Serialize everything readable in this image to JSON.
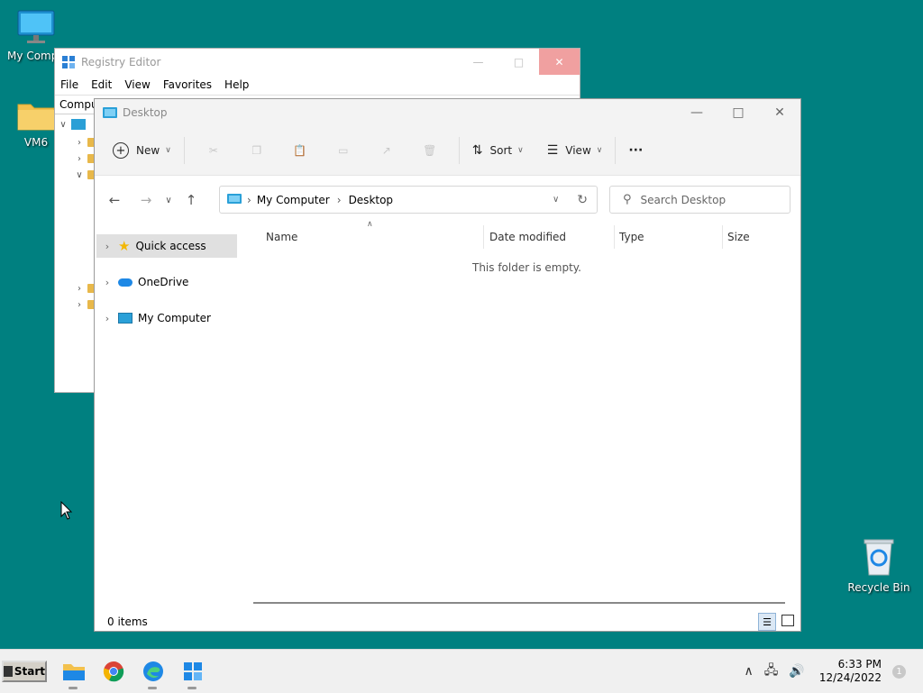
{
  "desktop": {
    "icons": [
      {
        "label": "My Compu"
      },
      {
        "label": "VM6"
      },
      {
        "label": "Recycle Bin"
      }
    ]
  },
  "regedit": {
    "title": "Registry Editor",
    "menu": [
      "File",
      "Edit",
      "View",
      "Favorites",
      "Help"
    ],
    "address": "Compu"
  },
  "explorer": {
    "title": "Desktop",
    "toolbar": {
      "new_label": "New",
      "sort_label": "Sort",
      "view_label": "View",
      "more_label": "···"
    },
    "breadcrumb": [
      "My Computer",
      "Desktop"
    ],
    "search_placeholder": "Search Desktop",
    "sidebar": [
      "Quick access",
      "OneDrive",
      "My Computer"
    ],
    "columns": [
      "Name",
      "Date modified",
      "Type",
      "Size"
    ],
    "empty_message": "This folder is empty.",
    "status": "0 items"
  },
  "taskbar": {
    "start_label": "Start",
    "time": "6:33 PM",
    "date": "12/24/2022",
    "notification_count": "1"
  }
}
